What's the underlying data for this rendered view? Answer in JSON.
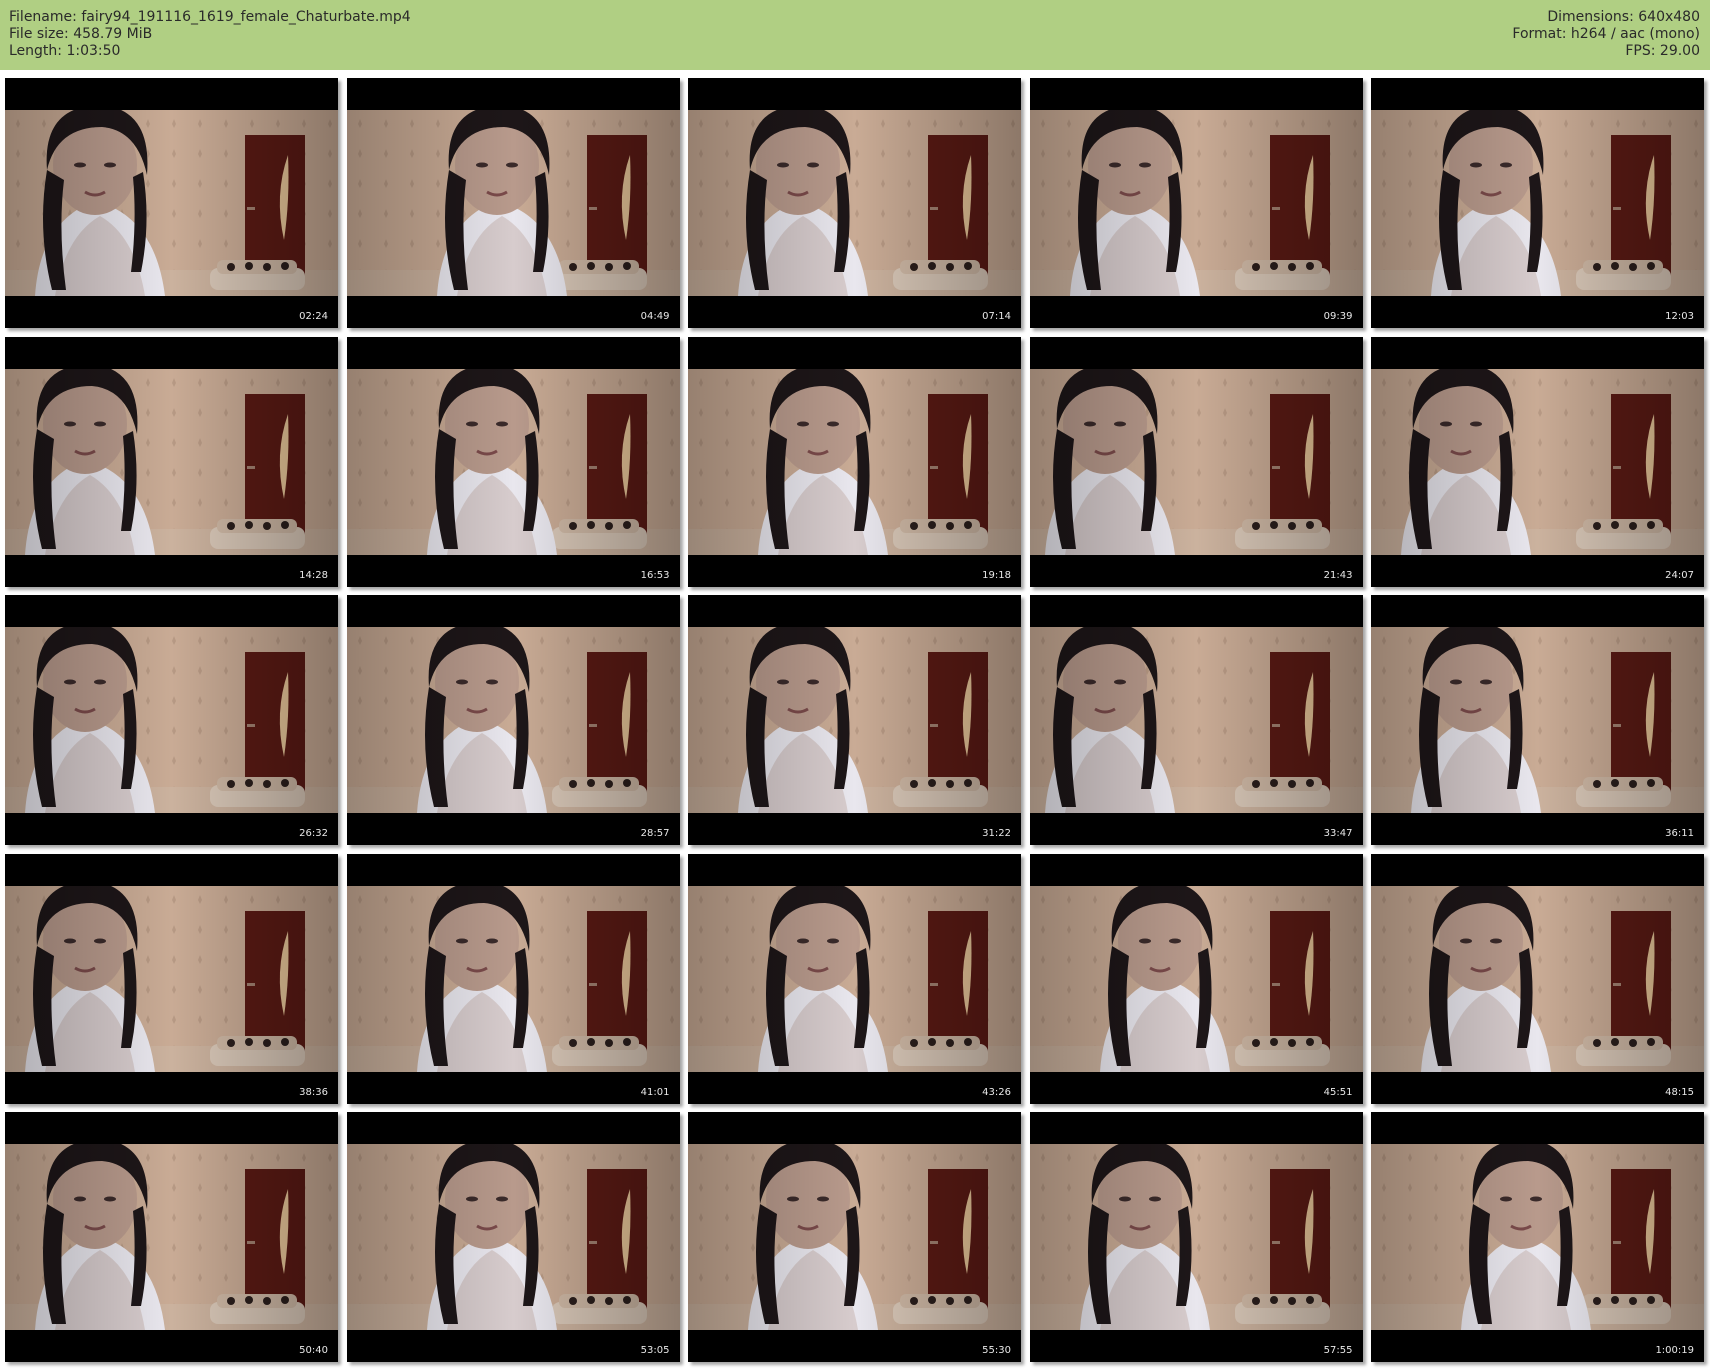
{
  "header": {
    "left": [
      {
        "label": "Filename:",
        "value": "fairy94_191116_1619_female_Chaturbate.mp4"
      },
      {
        "label": "File size:",
        "value": "458.79 MiB"
      },
      {
        "label": "Length:",
        "value": "1:03:50"
      }
    ],
    "right": [
      {
        "label": "Dimensions:",
        "value": "640x480"
      },
      {
        "label": "Format:",
        "value": "h264 / aac (mono)"
      },
      {
        "label": "FPS:",
        "value": "29.00"
      }
    ]
  },
  "thumbnails": [
    {
      "timestamp": "02:24"
    },
    {
      "timestamp": "04:49"
    },
    {
      "timestamp": "07:14"
    },
    {
      "timestamp": "09:39"
    },
    {
      "timestamp": "12:03"
    },
    {
      "timestamp": "14:28"
    },
    {
      "timestamp": "16:53"
    },
    {
      "timestamp": "19:18"
    },
    {
      "timestamp": "21:43"
    },
    {
      "timestamp": "24:07"
    },
    {
      "timestamp": "26:32"
    },
    {
      "timestamp": "28:57"
    },
    {
      "timestamp": "31:22"
    },
    {
      "timestamp": "33:47"
    },
    {
      "timestamp": "36:11"
    },
    {
      "timestamp": "38:36"
    },
    {
      "timestamp": "41:01"
    },
    {
      "timestamp": "43:26"
    },
    {
      "timestamp": "45:51"
    },
    {
      "timestamp": "48:15"
    },
    {
      "timestamp": "50:40"
    },
    {
      "timestamp": "53:05"
    },
    {
      "timestamp": "55:30"
    },
    {
      "timestamp": "57:55"
    },
    {
      "timestamp": "1:00:19"
    }
  ],
  "colors": {
    "header_bg": "#b0cf83",
    "wall": "#c9ab95",
    "door": "#5a1a14",
    "floor": "#cbb29e",
    "shirt": "#e9e7ee",
    "hair": "#1d1618"
  }
}
